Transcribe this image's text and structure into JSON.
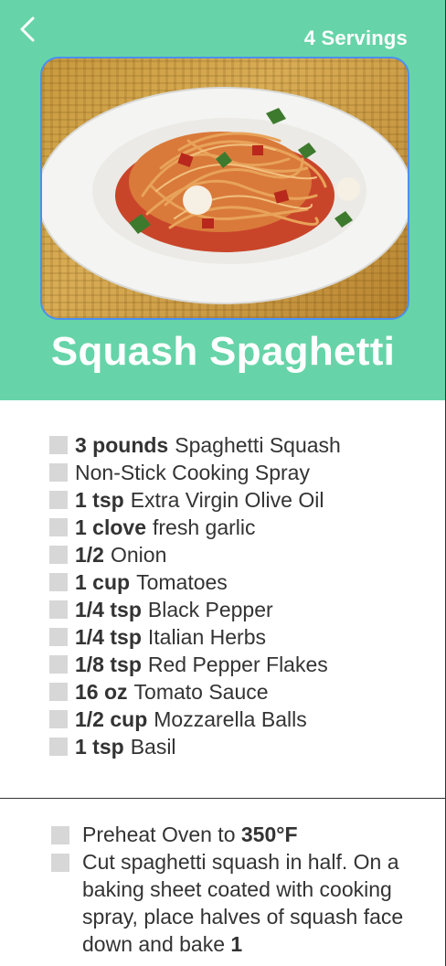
{
  "header": {
    "servings": "4 Servings",
    "title": "Squash Spaghetti",
    "photo_alt": "Squash Spaghetti",
    "colors": {
      "header_bg": "#66d4a8",
      "photo_border": "#4b8ff0"
    },
    "back_icon": "chevron-left-icon"
  },
  "ingredients": [
    {
      "qty": "3 pounds",
      "name": "Spaghetti Squash"
    },
    {
      "qty": "",
      "name": "Non-Stick Cooking Spray"
    },
    {
      "qty": "1 tsp",
      "name": "Extra Virgin Olive Oil"
    },
    {
      "qty": "1 clove",
      "name": "fresh garlic"
    },
    {
      "qty": "1/2",
      "name": "Onion"
    },
    {
      "qty": "1 cup",
      "name": "Tomatoes"
    },
    {
      "qty": "1/4 tsp",
      "name": "Black Pepper"
    },
    {
      "qty": "1/4 tsp",
      "name": "Italian Herbs"
    },
    {
      "qty": "1/8 tsp",
      "name": "Red Pepper Flakes"
    },
    {
      "qty": "16 oz",
      "name": "Tomato Sauce"
    },
    {
      "qty": "1/2 cup",
      "name": "Mozzarella Balls"
    },
    {
      "qty": "1 tsp",
      "name": "Basil"
    }
  ],
  "directions": [
    {
      "pre": "Preheat Oven to ",
      "bold": "350°F",
      "post": ""
    },
    {
      "pre": "Cut spaghetti squash in half. On a baking sheet coated with cooking spray, place halves of squash face down and bake ",
      "bold": "1",
      "post": ""
    }
  ]
}
